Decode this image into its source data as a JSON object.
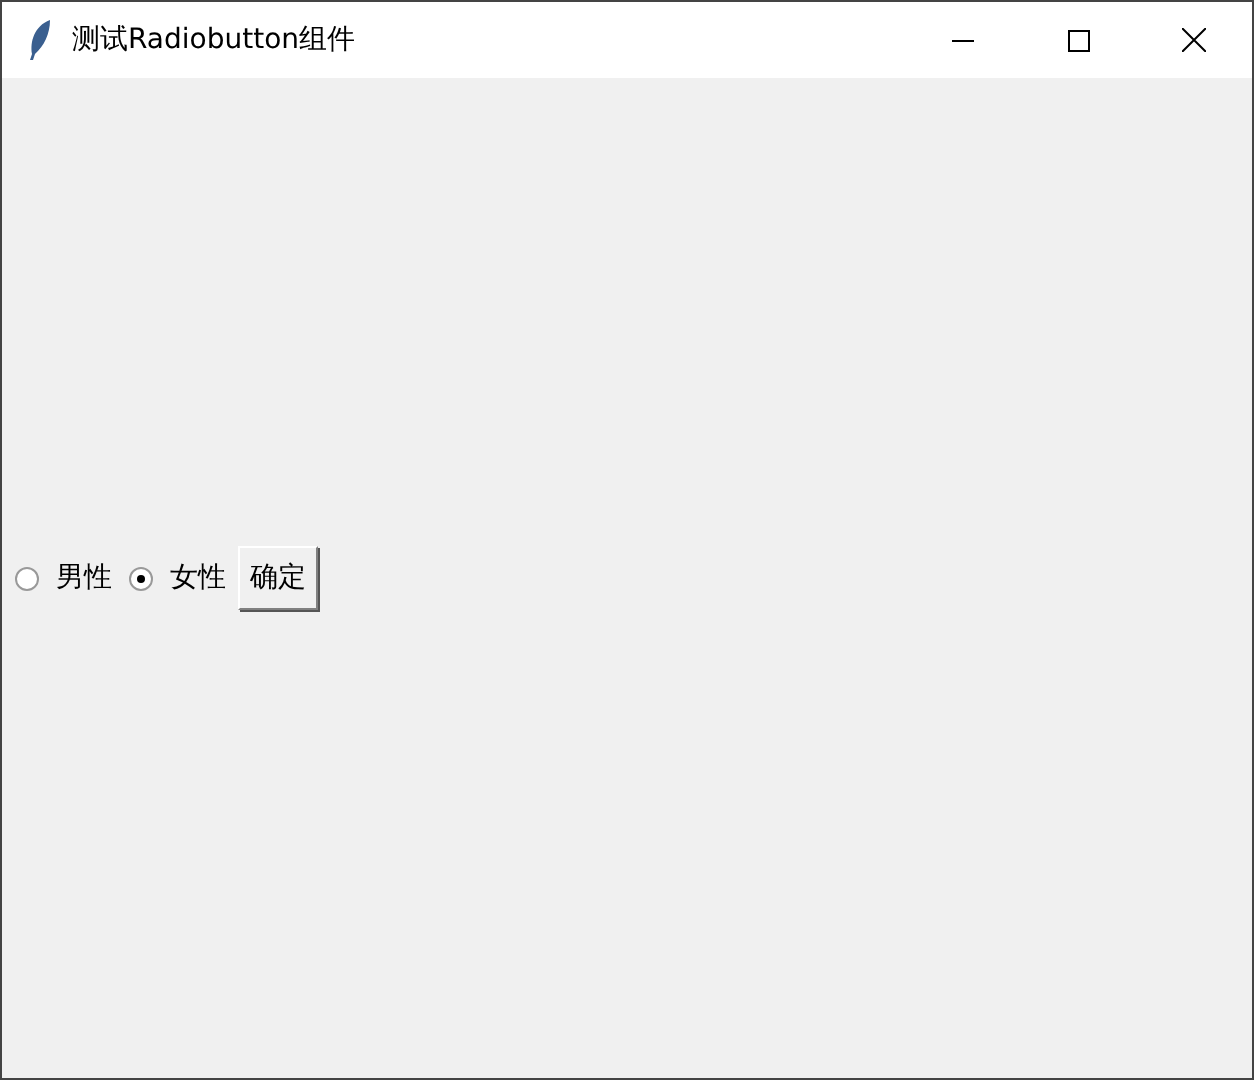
{
  "window": {
    "title": "测试Radiobutton组件"
  },
  "radios": [
    {
      "label": "男性",
      "selected": false
    },
    {
      "label": "女性",
      "selected": true
    }
  ],
  "button": {
    "label": "确定"
  }
}
